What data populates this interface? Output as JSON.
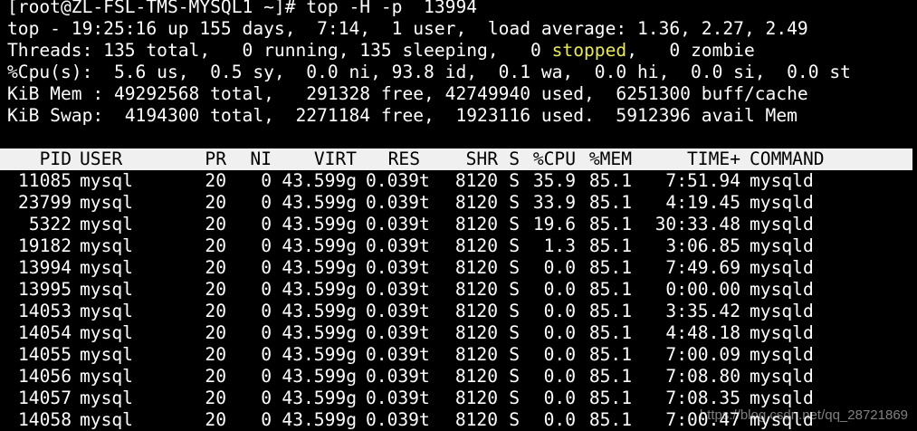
{
  "prompt": "[root@ZL-FSL-TMS-MYSQL1 ~]# top -H -p  13994",
  "summary": {
    "uptime_line": "top - 19:25:16 up 155 days,  7:14,  1 user,  load average: 1.36, 2.27, 2.49",
    "threads_prefix": "Threads: 135 total,   0 running, 135 sleeping,   0 ",
    "threads_stopped": "stopped",
    "threads_suffix": ",   0 zombie",
    "cpu_line": "%Cpu(s):  5.6 us,  0.5 sy,  0.0 ni, 93.8 id,  0.1 wa,  0.0 hi,  0.0 si,  0.0 st",
    "mem_line": "KiB Mem : 49292568 total,   291328 free, 42749940 used,  6251300 buff/cache",
    "swap_line": "KiB Swap:  4194300 total,  2271184 free,  1923116 used.  5912396 avail Mem"
  },
  "table": {
    "headers": [
      "PID",
      "USER",
      "PR",
      "NI",
      "VIRT",
      "RES",
      "SHR",
      "S",
      "%CPU",
      "%MEM",
      "TIME+",
      "COMMAND"
    ],
    "rows": [
      [
        "11085",
        "mysql",
        "20",
        "0",
        "43.599g",
        "0.039t",
        "8120",
        "S",
        "35.9",
        "85.1",
        "7:51.94",
        "mysqld"
      ],
      [
        "23799",
        "mysql",
        "20",
        "0",
        "43.599g",
        "0.039t",
        "8120",
        "S",
        "33.9",
        "85.1",
        "4:19.45",
        "mysqld"
      ],
      [
        "5322",
        "mysql",
        "20",
        "0",
        "43.599g",
        "0.039t",
        "8120",
        "S",
        "19.6",
        "85.1",
        "30:33.48",
        "mysqld"
      ],
      [
        "19182",
        "mysql",
        "20",
        "0",
        "43.599g",
        "0.039t",
        "8120",
        "S",
        "1.3",
        "85.1",
        "3:06.85",
        "mysqld"
      ],
      [
        "13994",
        "mysql",
        "20",
        "0",
        "43.599g",
        "0.039t",
        "8120",
        "S",
        "0.0",
        "85.1",
        "7:49.69",
        "mysqld"
      ],
      [
        "13995",
        "mysql",
        "20",
        "0",
        "43.599g",
        "0.039t",
        "8120",
        "S",
        "0.0",
        "85.1",
        "0:00.00",
        "mysqld"
      ],
      [
        "14053",
        "mysql",
        "20",
        "0",
        "43.599g",
        "0.039t",
        "8120",
        "S",
        "0.0",
        "85.1",
        "3:35.42",
        "mysqld"
      ],
      [
        "14054",
        "mysql",
        "20",
        "0",
        "43.599g",
        "0.039t",
        "8120",
        "S",
        "0.0",
        "85.1",
        "4:48.18",
        "mysqld"
      ],
      [
        "14055",
        "mysql",
        "20",
        "0",
        "43.599g",
        "0.039t",
        "8120",
        "S",
        "0.0",
        "85.1",
        "7:00.09",
        "mysqld"
      ],
      [
        "14056",
        "mysql",
        "20",
        "0",
        "43.599g",
        "0.039t",
        "8120",
        "S",
        "0.0",
        "85.1",
        "7:08.80",
        "mysqld"
      ],
      [
        "14057",
        "mysql",
        "20",
        "0",
        "43.599g",
        "0.039t",
        "8120",
        "S",
        "0.0",
        "85.1",
        "7:08.35",
        "mysqld"
      ],
      [
        "14058",
        "mysql",
        "20",
        "0",
        "43.599g",
        "0.039t",
        "8120",
        "S",
        "0.0",
        "85.1",
        "7:00.47",
        "mysqld"
      ]
    ]
  },
  "watermark": "https://blog.csdn.net/qq_28721869",
  "colors": {
    "background": "#000000",
    "text": "#ffffff",
    "header_bar": "#f0f0f0",
    "stopped": "#e8e85a"
  }
}
